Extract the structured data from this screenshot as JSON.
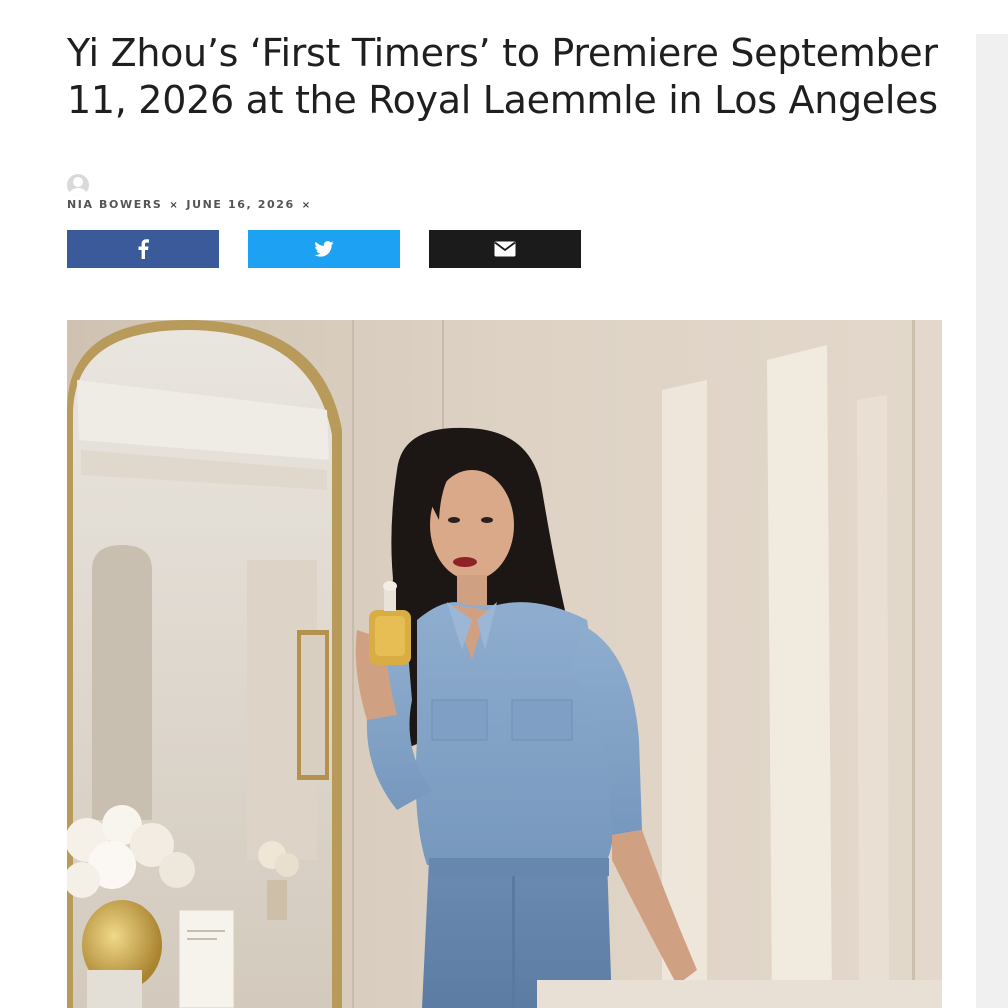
{
  "article": {
    "title": "Yi Zhou’s ‘First Timers’ to Premiere September 11, 2026 at the Royal Laemmle in Los Angeles",
    "author": "NIA BOWERS",
    "date": "JUNE 16, 2026",
    "separator": "×"
  },
  "share": {
    "facebook": {
      "icon": "facebook-icon",
      "color": "#3b5a9a"
    },
    "twitter": {
      "icon": "twitter-icon",
      "color": "#1da1f2"
    },
    "email": {
      "icon": "envelope-icon",
      "color": "#1b1b1b"
    }
  },
  "image": {
    "subject": "featured-photo"
  }
}
